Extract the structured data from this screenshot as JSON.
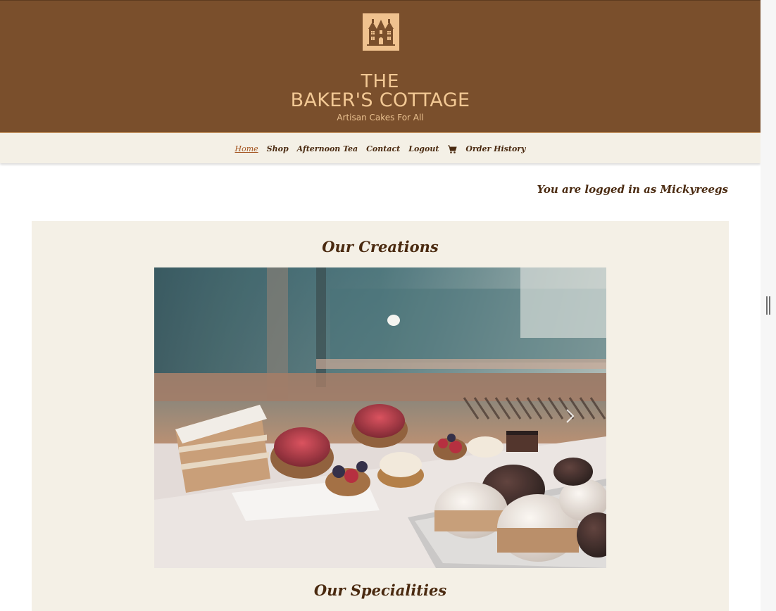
{
  "brand": {
    "line1": "THE",
    "line2": "BAKER'S COTTAGE",
    "tagline": "Artisan Cakes For All",
    "logo_icon": "cottage-logo-icon"
  },
  "nav": {
    "items": [
      {
        "label": "Home",
        "active": true
      },
      {
        "label": "Shop"
      },
      {
        "label": "Afternoon Tea"
      },
      {
        "label": "Contact"
      },
      {
        "label": "Logout"
      },
      {
        "label": "Order History"
      }
    ],
    "cart_icon": "shopping-cart-icon"
  },
  "user": {
    "logged_in_text": "You are logged in as Mickyreegs"
  },
  "sections": {
    "creations_title": "Our Creations",
    "specialities_title": "Our Specialities"
  },
  "carousel": {
    "next_icon": "chevron-right-icon"
  },
  "colors": {
    "header_bg": "#7a4f2c",
    "brand_text": "#f2c894",
    "nav_bg": "#f4f0e6",
    "text_brown": "#4a2a10",
    "active_link": "#a3541f"
  }
}
